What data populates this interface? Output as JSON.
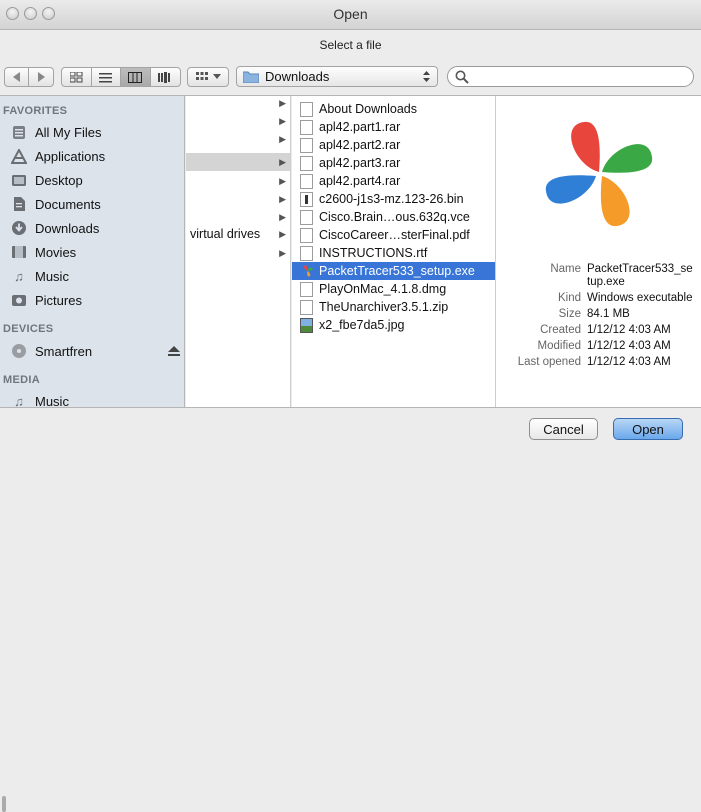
{
  "window": {
    "title": "Open",
    "subtitle": "Select a file"
  },
  "toolbar": {
    "back_icon": "back-arrow-icon",
    "forward_icon": "forward-arrow-icon",
    "view_modes": [
      "icon-view",
      "list-view",
      "column-view",
      "coverflow-view"
    ],
    "active_view": "column-view",
    "arrange_icon": "arrange-grid-icon",
    "location": "Downloads",
    "search_placeholder": ""
  },
  "sidebar": {
    "favorites_label": "FAVORITES",
    "favorites": [
      {
        "label": "All My Files",
        "icon": "all-files-icon"
      },
      {
        "label": "Applications",
        "icon": "applications-icon"
      },
      {
        "label": "Desktop",
        "icon": "desktop-icon"
      },
      {
        "label": "Documents",
        "icon": "documents-icon"
      },
      {
        "label": "Downloads",
        "icon": "downloads-icon"
      },
      {
        "label": "Movies",
        "icon": "movies-icon"
      },
      {
        "label": "Music",
        "icon": "music-icon"
      },
      {
        "label": "Pictures",
        "icon": "pictures-icon"
      }
    ],
    "devices_label": "DEVICES",
    "devices": [
      {
        "label": "Smartfren",
        "icon": "disk-icon"
      }
    ],
    "media_label": "MEDIA",
    "media": [
      {
        "label": "Music",
        "icon": "music-icon"
      }
    ]
  },
  "column1": {
    "items": [
      {
        "label": "",
        "highlight": true
      },
      {
        "label": "virtual drives"
      }
    ]
  },
  "column2": {
    "items": [
      {
        "label": "About Downloads",
        "icon": "document-icon"
      },
      {
        "label": "apl42.part1.rar",
        "icon": "document-icon"
      },
      {
        "label": "apl42.part2.rar",
        "icon": "document-icon"
      },
      {
        "label": "apl42.part3.rar",
        "icon": "document-icon"
      },
      {
        "label": "apl42.part4.rar",
        "icon": "document-icon"
      },
      {
        "label": "c2600-j1s3-mz.123-26.bin",
        "icon": "binary-file-icon"
      },
      {
        "label": "Cisco.Brain…ous.632q.vce",
        "icon": "document-icon"
      },
      {
        "label": "CiscoCareer…sterFinal.pdf",
        "icon": "document-icon"
      },
      {
        "label": "INSTRUCTIONS.rtf",
        "icon": "document-icon"
      },
      {
        "label": "PacketTracer533_setup.exe",
        "icon": "packettracer-icon",
        "selected": true
      },
      {
        "label": "PlayOnMac_4.1.8.dmg",
        "icon": "document-icon"
      },
      {
        "label": "TheUnarchiver3.5.1.zip",
        "icon": "document-icon"
      },
      {
        "label": "x2_fbe7da5.jpg",
        "icon": "image-file-icon"
      }
    ]
  },
  "preview": {
    "icon": "packettracer-clover-icon",
    "name_label": "Name",
    "name_value_1": "PacketTracer533_se",
    "name_value_2": "tup.exe",
    "kind_label": "Kind",
    "kind_value": "Windows executable",
    "size_label": "Size",
    "size_value": "84.1 MB",
    "created_label": "Created",
    "created_value": "1/12/12 4:03 AM",
    "modified_label": "Modified",
    "modified_value": "1/12/12 4:03 AM",
    "last_opened_label": "Last opened",
    "last_opened_value": "1/12/12 4:03 AM"
  },
  "buttons": {
    "cancel": "Cancel",
    "open": "Open"
  },
  "colors": {
    "selection": "#3875d7",
    "sidebar_bg": "#dce3eb",
    "open_button": "#6aa8ec"
  }
}
